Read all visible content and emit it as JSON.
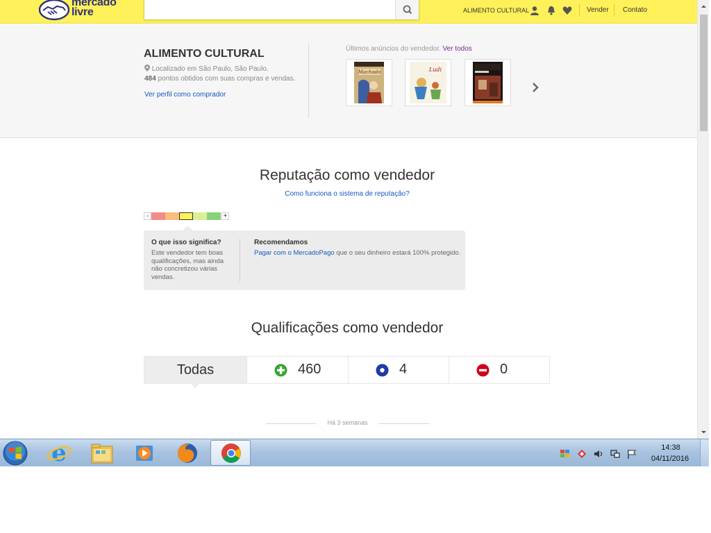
{
  "header": {
    "logo_line1": "mercado",
    "logo_line2": "livre",
    "search": {
      "value": "",
      "placeholder": ""
    },
    "user_name": "ALIMENTO CULTURAL",
    "nav_sell": "Vender",
    "nav_contact": "Contato"
  },
  "seller": {
    "name": "ALIMENTO CULTURAL",
    "location": "Localizado em São Paulo, São Paulo.",
    "points_value": "484",
    "points_text": " pontos obtidos com suas compras e vendas.",
    "profile_link": "Ver perfil como comprador",
    "latest_label": "Últimos anúncios do vendedor.",
    "see_all": "Ver todos",
    "books": [
      {
        "title": "Machado e Juca",
        "cover_color": "#c9b37a"
      },
      {
        "title": "Ludi",
        "cover_color": "#f4f0e2"
      },
      {
        "title": "Pedagogia da Autonomia",
        "cover_color": "#b1361e"
      }
    ]
  },
  "reputation": {
    "title": "Reputação como vendedor",
    "help_link": "Como funciona o sistema de reputação?",
    "thermometer": {
      "min_label": "-",
      "max_label": "+",
      "level": 3,
      "levels": 5,
      "colors": [
        "#f28b8b",
        "#f9bd7c",
        "#fff159",
        "#dbef99",
        "#86d27a"
      ]
    },
    "meaning_title": "O que isso significa?",
    "meaning_text": "Este vendedor tem boas qualificações, mas ainda não concretizou várias vendas.",
    "recommend_title": "Recomendamos",
    "recommend_link": "Pagar com o MercadoPago",
    "recommend_text": " que o seu dinheiro estará 100% protegido."
  },
  "qualifications": {
    "title": "Qualificações como vendedor",
    "tab_all": "Todas",
    "positive": "460",
    "neutral": "4",
    "negative": "0",
    "colors": {
      "positive": "#39a330",
      "neutral": "#1d3aa8",
      "negative": "#d0021b"
    },
    "time_label": "Há 3 semanas"
  },
  "taskbar": {
    "time": "14:38",
    "date": "04/11/2016",
    "apps": [
      "windows-start",
      "internet-explorer",
      "file-explorer",
      "media-player",
      "firefox",
      "chrome"
    ]
  }
}
